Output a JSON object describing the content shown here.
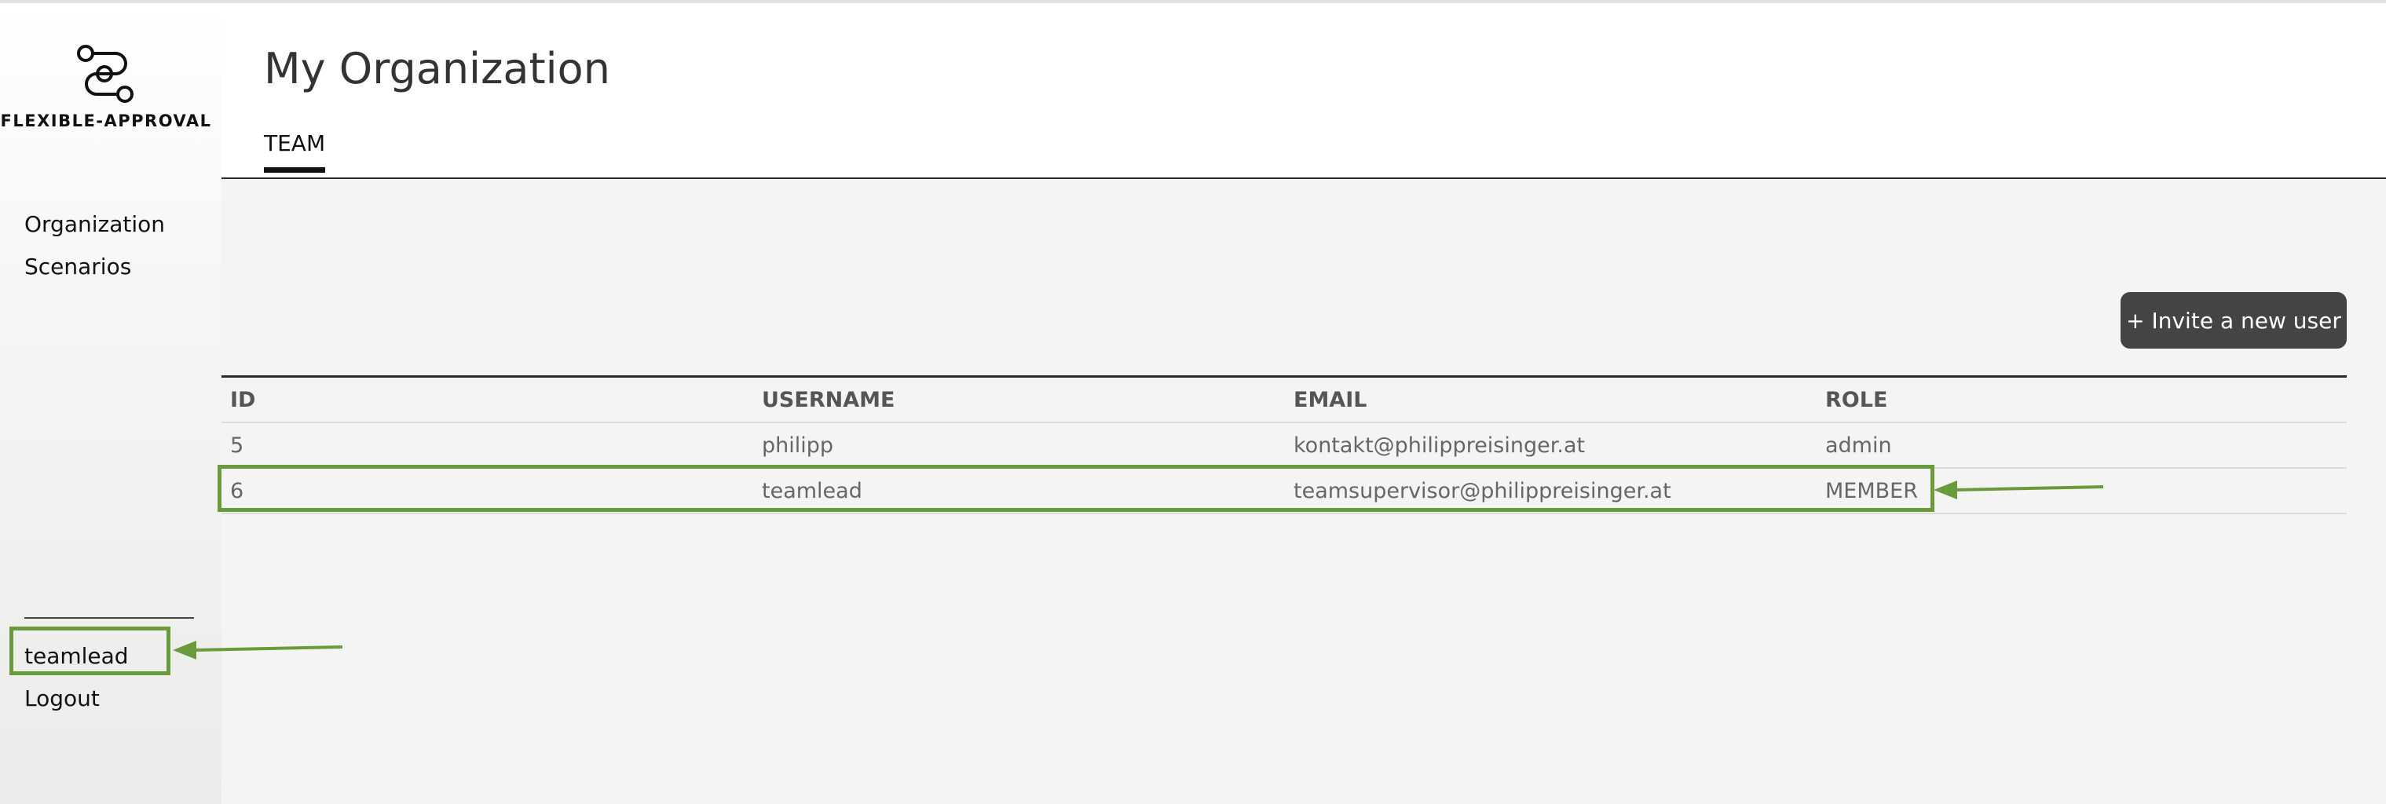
{
  "sidebar": {
    "logo_text": "FLEXIBLE-APPROVAL",
    "logo_icon": "workflow-icon",
    "nav": [
      {
        "label": "Organization"
      },
      {
        "label": "Scenarios"
      }
    ],
    "user_name": "teamlead",
    "logout_label": "Logout"
  },
  "header": {
    "title": "My Organization",
    "tabs": [
      {
        "label": "TEAM",
        "active": true
      }
    ]
  },
  "main": {
    "invite_button": "+ Invite a new user",
    "table": {
      "columns": [
        "ID",
        "USERNAME",
        "EMAIL",
        "ROLE"
      ],
      "rows": [
        {
          "id": "5",
          "username": "philipp",
          "email": "kontakt@philippreisinger.at",
          "role": "admin"
        },
        {
          "id": "6",
          "username": "teamlead",
          "email": "teamsupervisor@philippreisinger.at",
          "role": "MEMBER"
        }
      ]
    }
  },
  "colors": {
    "annotation": "#6b9a3c",
    "button_bg": "#444444",
    "content_bg": "#f4f4f4"
  }
}
